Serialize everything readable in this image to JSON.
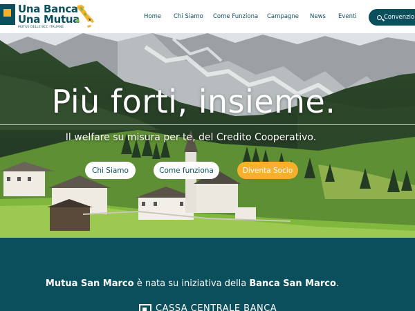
{
  "logo": {
    "line1": "Una Banca",
    "line2": "Una Mutua",
    "tagline": "MUTUE DELLE BCC ITALIANE",
    "brand_color": "#0c4f5c",
    "accent_color": "#f7b02a"
  },
  "nav": {
    "items": [
      {
        "label": "Home"
      },
      {
        "label": "Chi Siamo"
      },
      {
        "label": "Come Funziona"
      },
      {
        "label": "Campagne"
      },
      {
        "label": "News"
      },
      {
        "label": "Eventi"
      }
    ],
    "cta_label": "Convenzioni",
    "cta_icon": "search-icon"
  },
  "hero": {
    "title": "Più forti, insieme.",
    "subtitle": "Il welfare su misura per te, del Credito Cooperativo.",
    "buttons": {
      "chi_siamo": "Chi Siamo",
      "come_funziona": "Come funziona",
      "diventa_socio": "Diventa Socio"
    }
  },
  "about": {
    "mutua_name": "Mutua San Marco",
    "text_middle": " è nata su iniziativa della ",
    "bank_name": "Banca San Marco",
    "text_end": ".",
    "partner_logo_text": "CASSA CENTRALE BANCA"
  }
}
